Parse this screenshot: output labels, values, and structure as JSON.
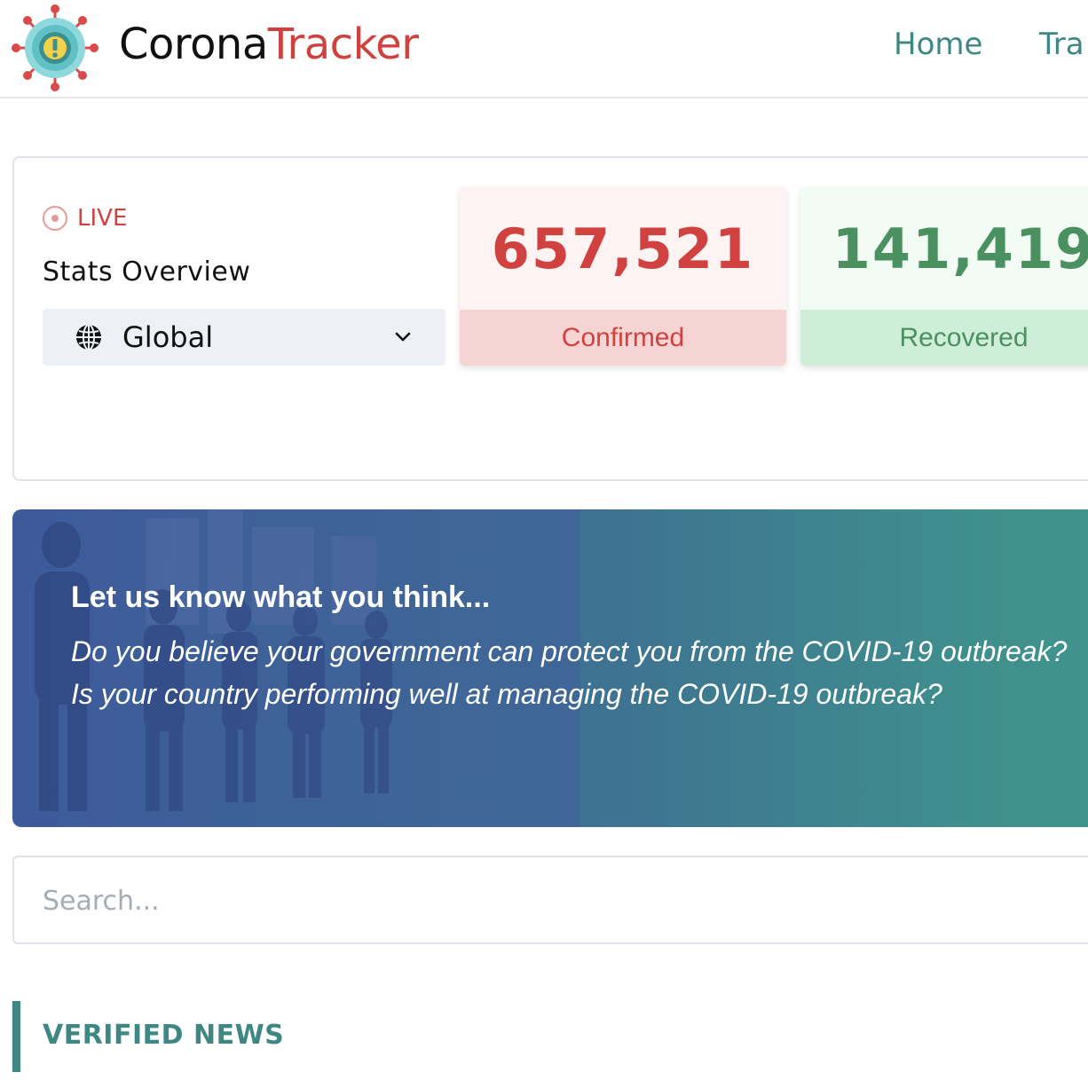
{
  "header": {
    "brand_part1": "Corona",
    "brand_part2": "Tracker",
    "logo_icon": "virus-warning-icon",
    "nav": [
      {
        "label": "Home"
      },
      {
        "label": "Tra"
      }
    ]
  },
  "stats": {
    "live_label": "LIVE",
    "title": "Stats Overview",
    "region": {
      "selected": "Global",
      "icon": "globe-icon",
      "dropdown_icon": "chevron-down-icon"
    },
    "metrics": [
      {
        "value": "657,521",
        "label": "Confirmed"
      },
      {
        "value": "141,419",
        "label": "Recovered"
      }
    ]
  },
  "banner": {
    "title": "Let us know what you think...",
    "line1": "Do you believe your government can protect you from the COVID-19 outbreak?",
    "line2": "Is your country performing well at managing the COVID-19 outbreak?"
  },
  "search": {
    "placeholder": "Search..."
  },
  "news": {
    "heading": "VERIFIED NEWS"
  },
  "colors": {
    "brand_red": "#d0423f",
    "brand_teal": "#3f8783",
    "recovered_green": "#4a9060"
  }
}
